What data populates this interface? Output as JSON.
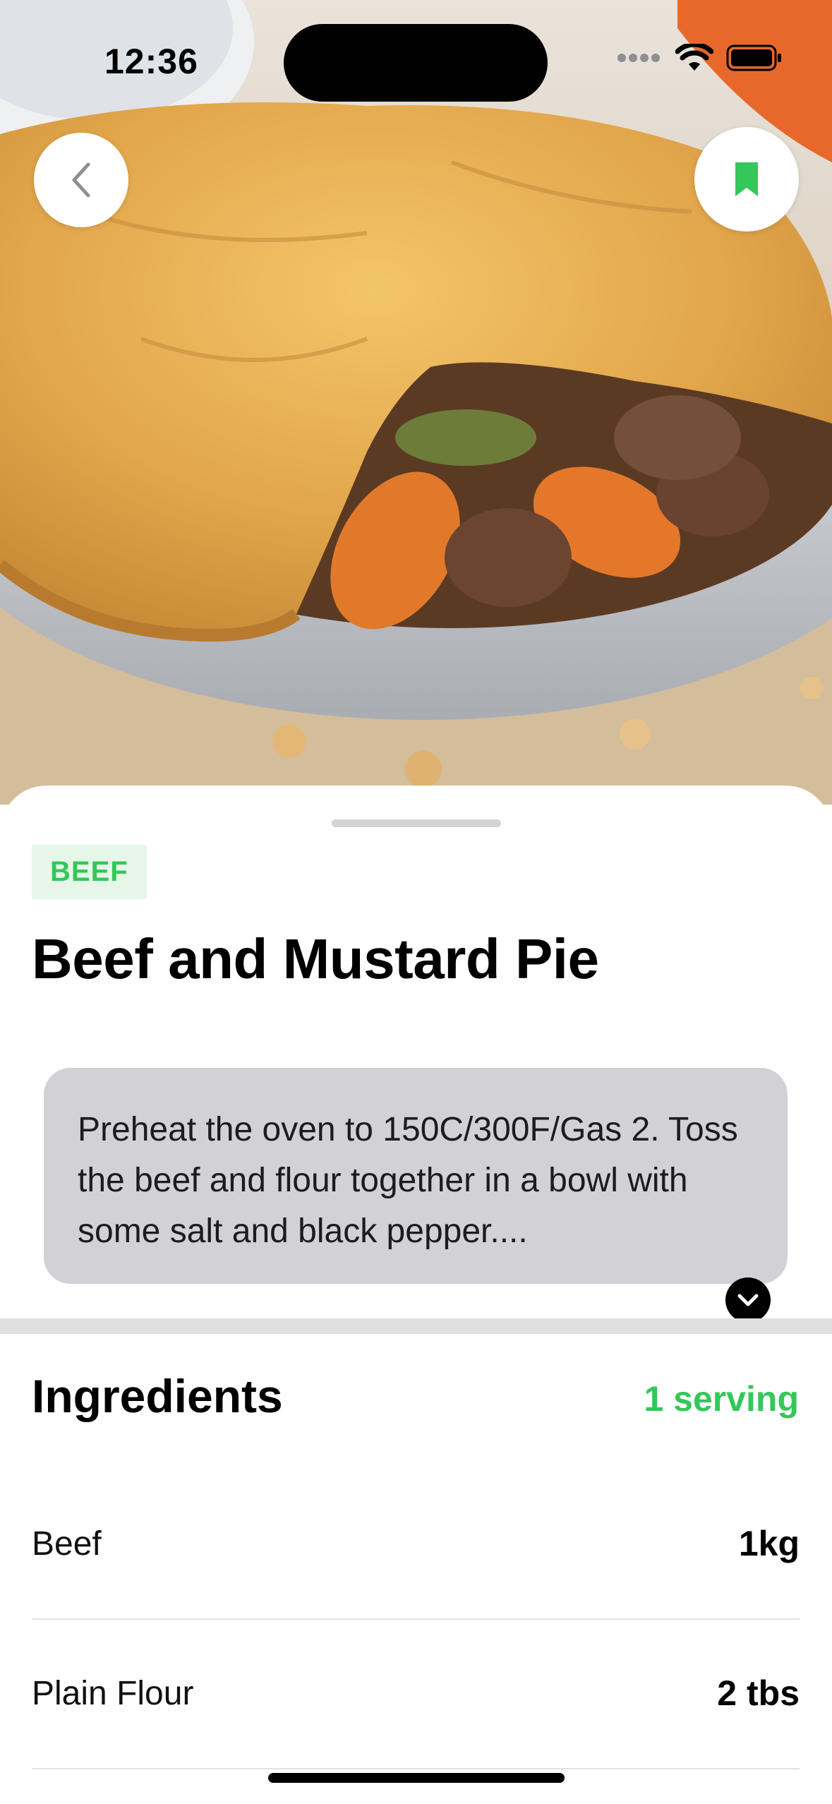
{
  "status_bar": {
    "time": "12:36"
  },
  "hero": {
    "image_alt": "Beef and mustard pie in a dish"
  },
  "recipe": {
    "category": "BEEF",
    "title": "Beef and Mustard Pie",
    "description": "Preheat the oven to 150C/300F/Gas 2. Toss the beef and flour together in a bowl with some salt and black pepper...."
  },
  "ingredients": {
    "heading": "Ingredients",
    "serving_label": "1 serving",
    "items": [
      {
        "name": "Beef",
        "quantity": "1kg"
      },
      {
        "name": "Plain Flour",
        "quantity": "2 tbs"
      }
    ]
  },
  "icons": {
    "back": "chevron-left-icon",
    "bookmark": "bookmark-icon",
    "expand": "chevron-down-icon"
  },
  "colors": {
    "accent": "#34C759",
    "accent_bg": "#E6F7EA",
    "desc_bg": "#D1D1D6"
  }
}
